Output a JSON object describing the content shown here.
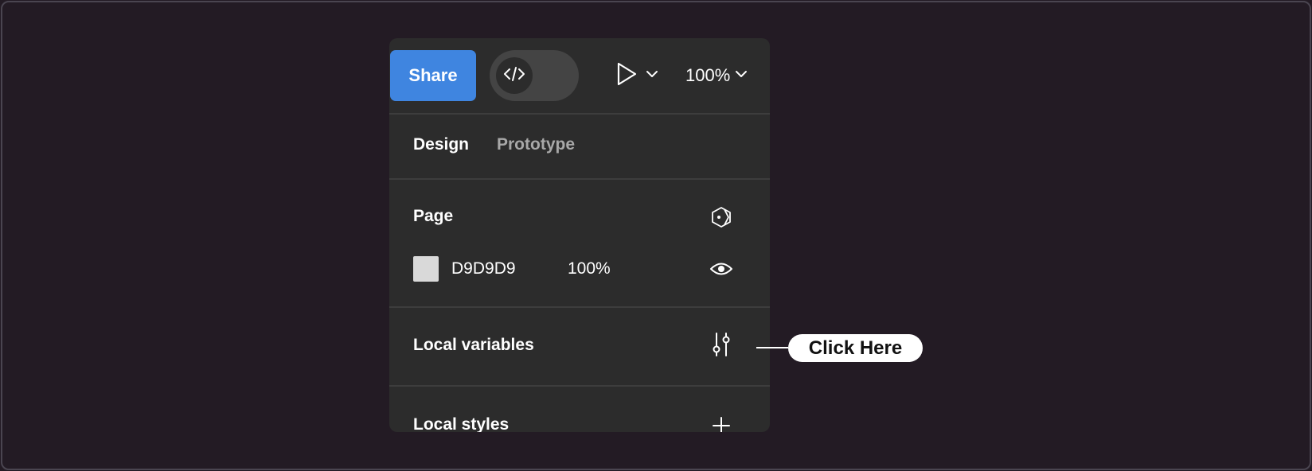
{
  "toolbar": {
    "share_label": "Share",
    "zoom_label": "100%",
    "icons": {
      "dev_mode": "code-icon",
      "present": "play-icon",
      "present_menu": "chevron-down-icon",
      "zoom_menu": "chevron-down-icon"
    }
  },
  "tabs": [
    {
      "label": "Design",
      "active": true
    },
    {
      "label": "Prototype",
      "active": false
    }
  ],
  "page_section": {
    "title": "Page",
    "fill_hex": "D9D9D9",
    "fill_opacity": "100%",
    "swatch_color": "#d9d9d9",
    "icons": {
      "action": "hexagon-icon",
      "visibility": "eye-icon"
    }
  },
  "local_variables": {
    "title": "Local variables",
    "icon": "sliders-icon"
  },
  "local_styles": {
    "title": "Local styles",
    "icon": "plus-icon"
  },
  "callout": {
    "label": "Click Here"
  },
  "colors": {
    "background": "#231b24",
    "panel": "#2c2c2c",
    "accent": "#3f85e0",
    "muted_text": "#a8a8a8"
  }
}
